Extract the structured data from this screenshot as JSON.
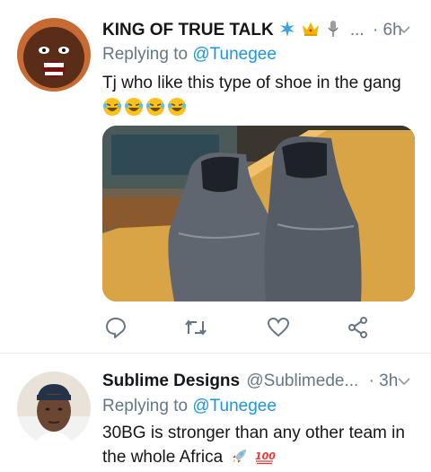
{
  "tweets": [
    {
      "author_name": "KING OF TRUE TALK",
      "name_emojis": [
        "sparkle-emoji",
        "crown-emoji",
        "microphone-emoji"
      ],
      "ellipsis": "...",
      "time": "· 6h",
      "replying_prefix": "Replying to",
      "replying_handle": "@Tunegee",
      "text": "Tj who like this type of shoe in the gang",
      "trailing_emojis": [
        "laughing-tears-emoji",
        "laughing-tears-emoji",
        "laughing-tears-emoji",
        "laughing-tears-emoji"
      ],
      "media": "photo of a pair of worn grey leather ankle boots on a wooden table"
    },
    {
      "author_name": "Sublime Designs",
      "handle": "@Sublimede...",
      "time": "· 3h",
      "replying_prefix": "Replying to",
      "replying_handle": "@Tunegee",
      "text_line1": "30BG is stronger than any other team in",
      "text_line2": "the whole Africa",
      "trailing_emojis": [
        "rocket-emoji",
        "hundred-points-emoji"
      ]
    }
  ],
  "actions": [
    "reply-icon",
    "retweet-icon",
    "like-icon",
    "share-icon"
  ],
  "colors": {
    "link": "#1b95e0",
    "secondary_text": "#657786",
    "icon": "#657786",
    "divider": "#e6ecf0"
  }
}
